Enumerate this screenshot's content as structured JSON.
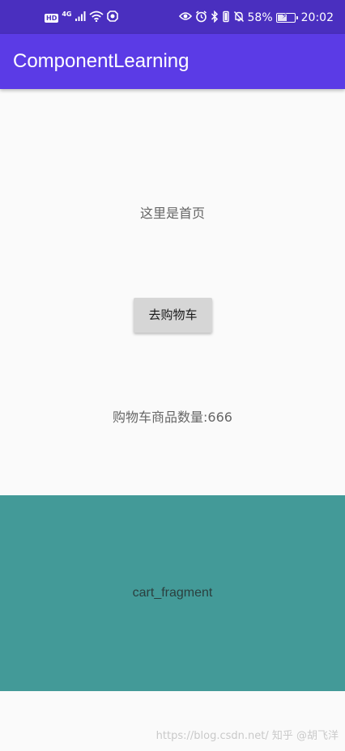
{
  "status_bar": {
    "hd_badge": "HD",
    "network_badge": "4G",
    "battery_percent": "58%",
    "battery_level": 0.58,
    "time": "20:02",
    "color": "#4a2fbf"
  },
  "app_bar": {
    "title": "ComponentLearning",
    "color": "#5b3be6"
  },
  "home": {
    "label": "这里是首页",
    "go_cart_button": "去购物车",
    "cart_count_text": "购物车商品数量:666"
  },
  "cart_fragment": {
    "label": "cart_fragment",
    "color": "#439a98"
  },
  "watermark": {
    "text": "https://blog.csdn.net/  知乎 @胡飞洋"
  },
  "icons": [
    "signal-icon",
    "wifi-icon",
    "shield-app-icon",
    "eye-icon",
    "alarm-icon",
    "bluetooth-icon",
    "vibrate-icon",
    "mute-icon",
    "battery-icon"
  ]
}
